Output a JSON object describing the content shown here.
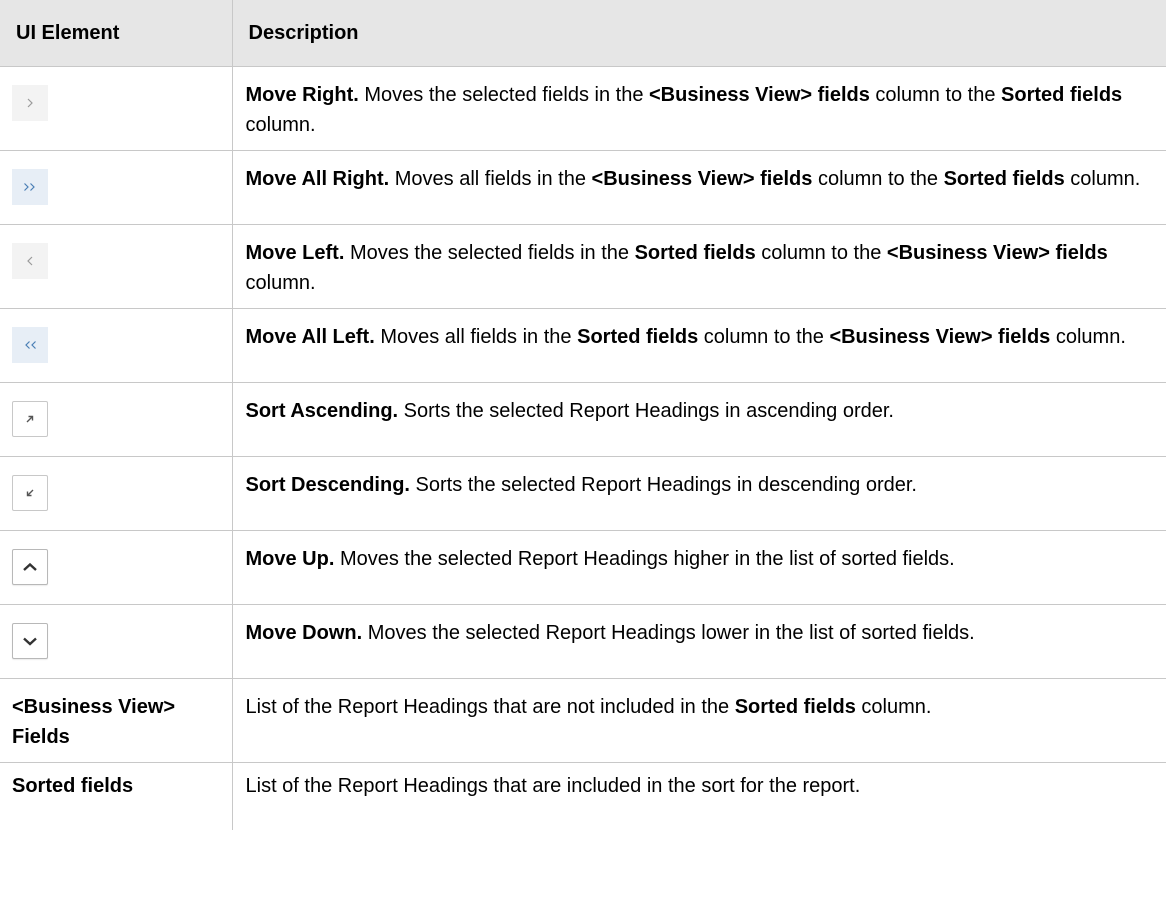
{
  "header": {
    "col1": "UI Element",
    "col2": "Description"
  },
  "rows": [
    {
      "icon": "chevron-right-icon",
      "title": "Move Right.",
      "t1": " Moves the selected fields in the ",
      "b1": "<Business View> fields",
      "t2": " column to the ",
      "b2": "Sorted fields",
      "t3": " column."
    },
    {
      "icon": "double-chevron-right-icon",
      "title": "Move All Right.",
      "t1": " Moves all fields in the ",
      "b1": "<Business View> fields",
      "t2": " column to the ",
      "b2": "Sorted fields",
      "t3": " column."
    },
    {
      "icon": "chevron-left-icon",
      "title": "Move Left.",
      "t1": " Moves the selected fields in the ",
      "b1": "Sorted fields",
      "t2": " column to the ",
      "b2": "<Business View> fields",
      "t3": " column."
    },
    {
      "icon": "double-chevron-left-icon",
      "title": "Move All Left.",
      "t1": " Moves all fields in the ",
      "b1": "Sorted fields",
      "t2": " column to the ",
      "b2": "<Business View> fields",
      "t3": " column."
    },
    {
      "icon": "sort-ascending-icon",
      "title": "Sort Ascending.",
      "text": " Sorts the selected Report Headings in ascending order."
    },
    {
      "icon": "sort-descending-icon",
      "title": "Sort Descending.",
      "text": " Sorts the selected Report Headings in descending order."
    },
    {
      "icon": "chevron-up-icon",
      "title": "Move Up.",
      "text": " Moves the selected Report Headings higher in the list of sorted fields."
    },
    {
      "icon": "chevron-down-icon",
      "title": "Move Down.",
      "text": " Moves the selected Report Headings lower in the list of sorted fields."
    },
    {
      "label": "<Business View> Fields",
      "t1": "List of the Report Headings that are not included in the ",
      "b1": "Sorted fields",
      "t2": " column."
    },
    {
      "label": "Sorted fields",
      "text": "List of the Report Headings that are included in the sort for the report."
    }
  ],
  "colors": {
    "header_bg": "#e6e6e6",
    "grid": "#c8c8c8",
    "icon_flat_bg": "#f3f3f3",
    "icon_blue_bg": "#e7eef6",
    "icon_blue_glyph": "#4a7fb5",
    "icon_gray_glyph": "#9a9a9a"
  }
}
